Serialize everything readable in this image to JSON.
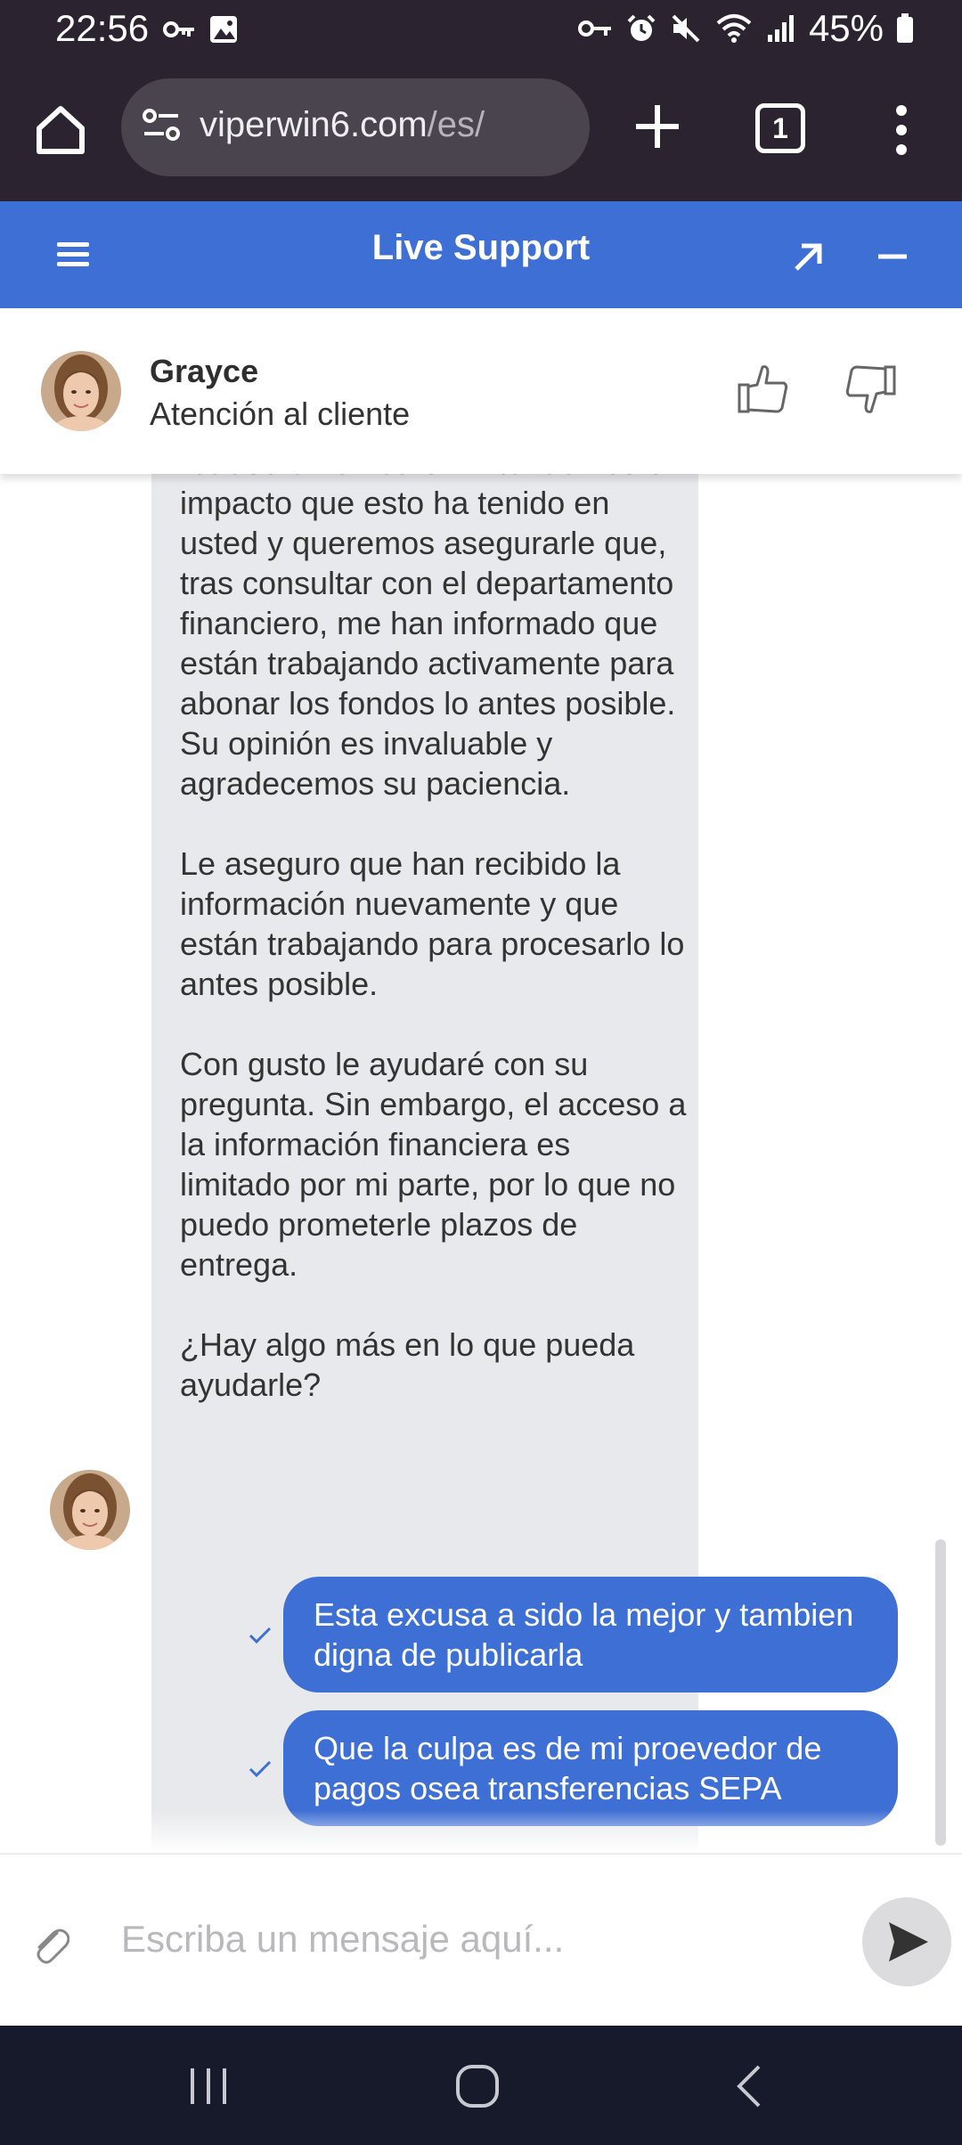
{
  "status_bar": {
    "time": "22:56",
    "battery": "45%",
    "left_icons": [
      "key-icon",
      "image-icon"
    ],
    "right_icons": [
      "vpn-key-icon",
      "alarm-icon",
      "mute-icon",
      "wifi-icon",
      "signal-icon",
      "battery-icon"
    ]
  },
  "browser": {
    "url_domain": "viperwin6.com",
    "url_path": "/es/",
    "tab_count": "1"
  },
  "chat_header": {
    "title": "Live Support"
  },
  "agent": {
    "name": "Grayce",
    "role": "Atención al cliente"
  },
  "conversation": {
    "agent_message_paragraphs": [
      "molestias causadas por el largo retraso en el retiro. Entendemos el impacto que esto ha tenido en usted y queremos asegurarle que, tras consultar con el departamento financiero, me han informado que están trabajando activamente para abonar los fondos lo antes posible. Su opinión es invaluable y agradecemos su paciencia.",
      "Le aseguro que han recibido la información nuevamente y que están trabajando para procesarlo lo antes posible.",
      "Con gusto le ayudaré con su pregunta. Sin embargo, el acceso a la información financiera es limitado por mi parte, por lo que no puedo prometerle plazos de entrega.",
      "¿Hay algo más en lo que pueda ayudarle?"
    ],
    "user_messages": [
      "Esta excusa a sido la mejor y tambien digna de publicarla",
      "Que la culpa es de mi proevedor de pagos osea transferencias SEPA"
    ]
  },
  "composer": {
    "placeholder": "Escriba un mensaje aquí..."
  },
  "colors": {
    "accent": "#3e6fd4",
    "agent_bubble": "#e8e9ec",
    "system_bar": "#2b2430",
    "nav_bar": "#161a2b"
  }
}
